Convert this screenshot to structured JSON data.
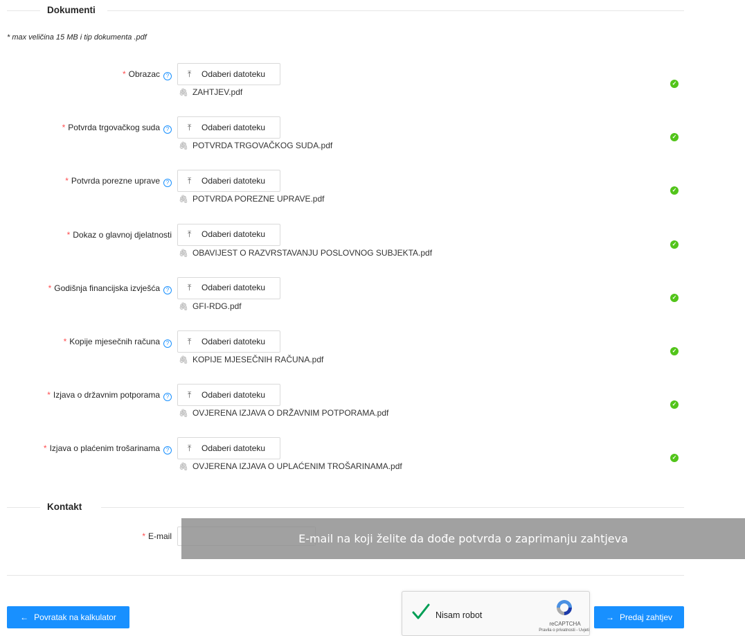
{
  "sections": {
    "documents_title": "Dokumenti",
    "contact_title": "Kontakt"
  },
  "note": "* max veličina 15 MB i tip dokumenta .pdf",
  "upload_button_label": "Odaberi datoteku",
  "required_mark": "*",
  "documents": [
    {
      "label": "Obrazac",
      "help": true,
      "file": "ZAHTJEV.pdf",
      "status": "ok"
    },
    {
      "label": "Potvrda trgovačkog suda",
      "help": true,
      "file": "POTVRDA TRGOVAČKOG SUDA.pdf",
      "status": "ok"
    },
    {
      "label": "Potvrda porezne uprave",
      "help": true,
      "file": "POTVRDA POREZNE UPRAVE.pdf",
      "status": "ok"
    },
    {
      "label": "Dokaz o glavnoj djelatnosti",
      "help": false,
      "file": "OBAVIJEST O RAZVRSTAVANJU POSLOVNOG SUBJEKTA.pdf",
      "status": "ok"
    },
    {
      "label": "Godišnja financijska izvješća",
      "help": true,
      "file": "GFI-RDG.pdf",
      "status": "ok"
    },
    {
      "label": "Kopije mjesečnih računa",
      "help": true,
      "file": "KOPIJE MJESEČNIH RAČUNA.pdf",
      "status": "ok"
    },
    {
      "label": "Izjava o državnim potporama",
      "help": true,
      "file": "OVJERENA IZJAVA O DRŽAVNIM POTPORAMA.pdf",
      "status": "ok"
    },
    {
      "label": "Izjava o plaćenim trošarinama",
      "help": true,
      "file": "OVJERENA IZJAVA O UPLAĆENIM TROŠARINAMA.pdf",
      "status": "ok"
    }
  ],
  "contact": {
    "email_label": "E-mail",
    "email_value": "",
    "tooltip": "E-mail na koji želite da dođe potvrda o zaprimanju zahtjeva"
  },
  "actions": {
    "back_label": "Povratak na kalkulator",
    "submit_label": "Predaj zahtjev"
  },
  "recaptcha": {
    "label": "Nisam robot",
    "brand": "reCAPTCHA",
    "terms": "Pravila o privatnosti - Uvjeti"
  },
  "colors": {
    "primary": "#1890ff",
    "success": "#52c41a",
    "required": "#ff4d4f"
  }
}
